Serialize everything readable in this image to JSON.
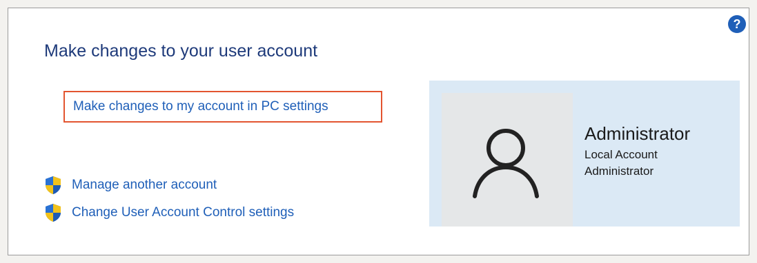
{
  "header": {
    "title": "Make changes to your user account",
    "help_icon": "question-mark-icon",
    "help_label": "?"
  },
  "main": {
    "pc_settings_link": "Make changes to my account in PC settings"
  },
  "tasks": [
    {
      "label": "Manage another account",
      "icon": "uac-shield-icon"
    },
    {
      "label": "Change User Account Control settings",
      "icon": "uac-shield-icon"
    }
  ],
  "account": {
    "name": "Administrator",
    "type": "Local Account",
    "role": "Administrator",
    "avatar_icon": "user-silhouette-icon"
  },
  "colors": {
    "link": "#1f5fb8",
    "title": "#1e3a7a",
    "highlight_border": "#e3542f",
    "panel_bg": "#dbe9f5",
    "shield_blue": "#1e5bb5",
    "shield_yellow": "#f2c21b"
  }
}
